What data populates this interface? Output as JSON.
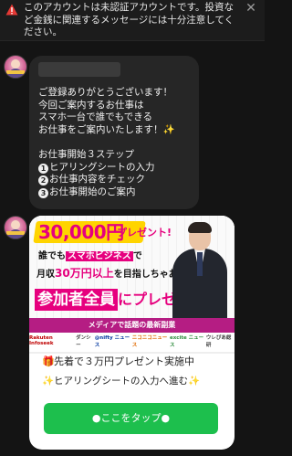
{
  "warning": {
    "text": "このアカウントは未認証アカウントです。投資など金銭に関連するメッセージには十分注意してください。",
    "close_icon": "close-icon",
    "alert_icon": "warning-triangle-icon",
    "alert_color": "#e53935"
  },
  "message1": {
    "body": "ご登録ありがとうございます！\n今回ご案内するお仕事は\nスマホ一台で誰でもできる\nお仕事をご案内いたします！✨\n\nお仕事開始３ステップ",
    "steps": [
      {
        "num": "1",
        "text": "ヒアリングシートの入力"
      },
      {
        "num": "2",
        "text": "お仕事内容をチェック"
      },
      {
        "num": "3",
        "text": "お仕事開始のご案内"
      }
    ]
  },
  "banner": {
    "prize_amount": "30,000円",
    "prize_suffix": "プレゼント!",
    "line1_pre": "誰でも",
    "line1_hl": "スマホビジネス",
    "line1_post": "で",
    "line2_pre": "月収",
    "line2_hl": "30万円以上",
    "line2_post": "を目指しちゃおう!!",
    "all_box": "参加者全員",
    "all_rest": "にプレゼント！",
    "media_caption": "メディアで話題の最新副業",
    "media_logos": [
      "Rakuten Infoseek",
      "ダンシー",
      "@nifty ニュース",
      "ニコニコニュース",
      "excite ニュース",
      "ウレぴあ総研"
    ],
    "accent_color": "#e6007e"
  },
  "card": {
    "line_a": "先着で３万円プレゼント実施中",
    "line_a_icon": "gift-icon",
    "line_b": "ヒアリングシートの入力へ進む",
    "line_b_icon": "sparkle-icon",
    "cta_label": "●ここをタップ●",
    "cta_color": "#1dbf4d"
  }
}
